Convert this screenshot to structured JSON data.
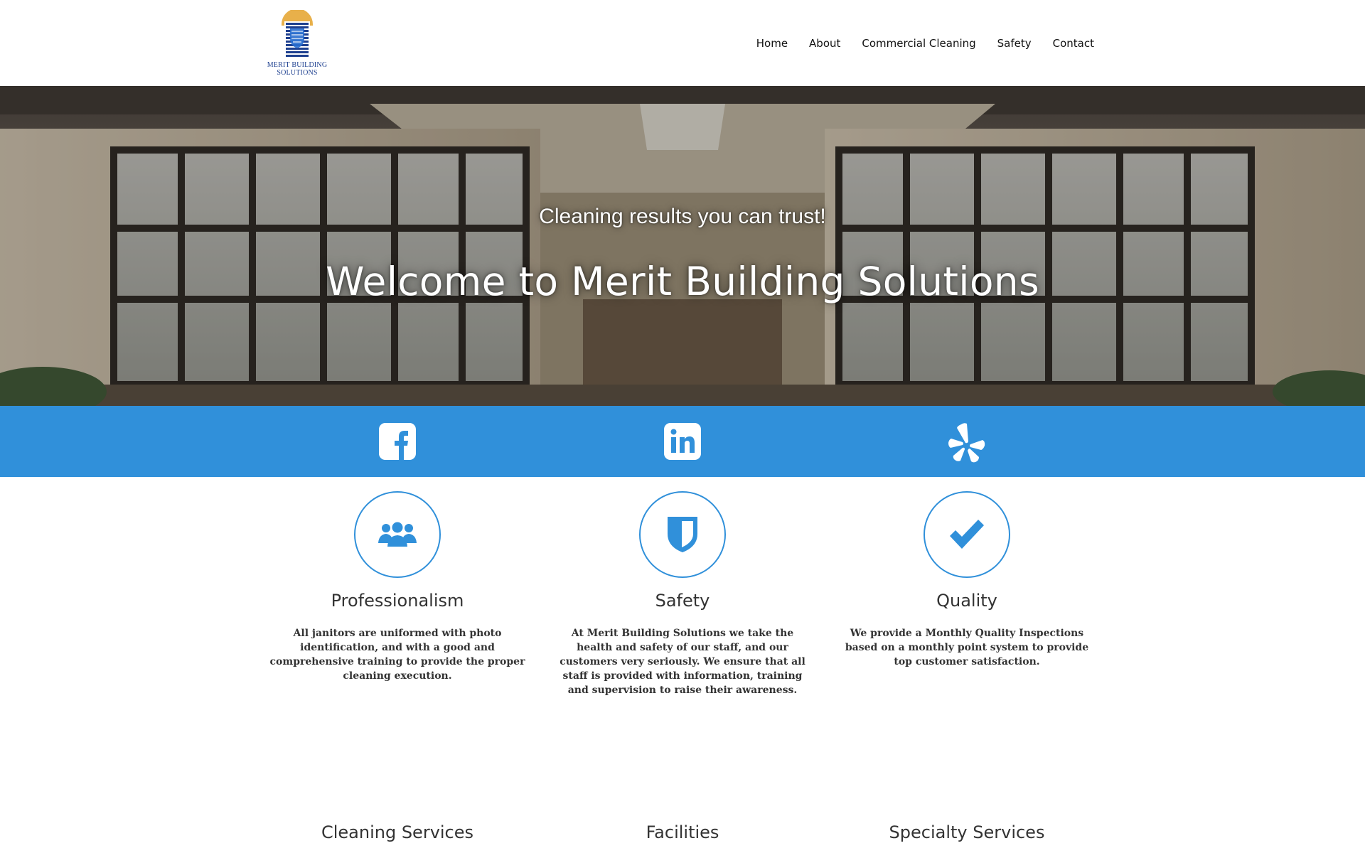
{
  "brand": {
    "logo_line1": "MERIT BUILDING",
    "logo_line2": "SOLUTIONS"
  },
  "nav": {
    "items": [
      {
        "label": "Home"
      },
      {
        "label": "About"
      },
      {
        "label": "Commercial Cleaning"
      },
      {
        "label": "Safety"
      },
      {
        "label": "Contact"
      }
    ]
  },
  "hero": {
    "tagline": "Cleaning results you can trust!",
    "title": "Welcome to Merit Building Solutions"
  },
  "social": {
    "icons": [
      "facebook-icon",
      "linkedin-icon",
      "yelp-icon"
    ]
  },
  "features": [
    {
      "icon": "people-icon",
      "title": "Professionalism",
      "text": "All janitors are uniformed with photo identification, and with a good and comprehensive training to provide the proper cleaning execution."
    },
    {
      "icon": "shield-icon",
      "title": "Safety",
      "text": "At Merit Building Solutions we take the health and safety of our staff, and our customers very seriously. We ensure that all staff is provided with information, training and supervision to raise their awareness."
    },
    {
      "icon": "checkmark-icon",
      "title": "Quality",
      "text": "We provide a Monthly Quality Inspections based on a monthly point system to provide top customer satisfaction."
    }
  ],
  "sections": [
    {
      "title": "Cleaning Services"
    },
    {
      "title": "Facilities"
    },
    {
      "title": "Specialty Services"
    }
  ],
  "colors": {
    "accent": "#3090da",
    "logo_blue": "#1d3f8f",
    "logo_gold": "#e8b04a"
  }
}
